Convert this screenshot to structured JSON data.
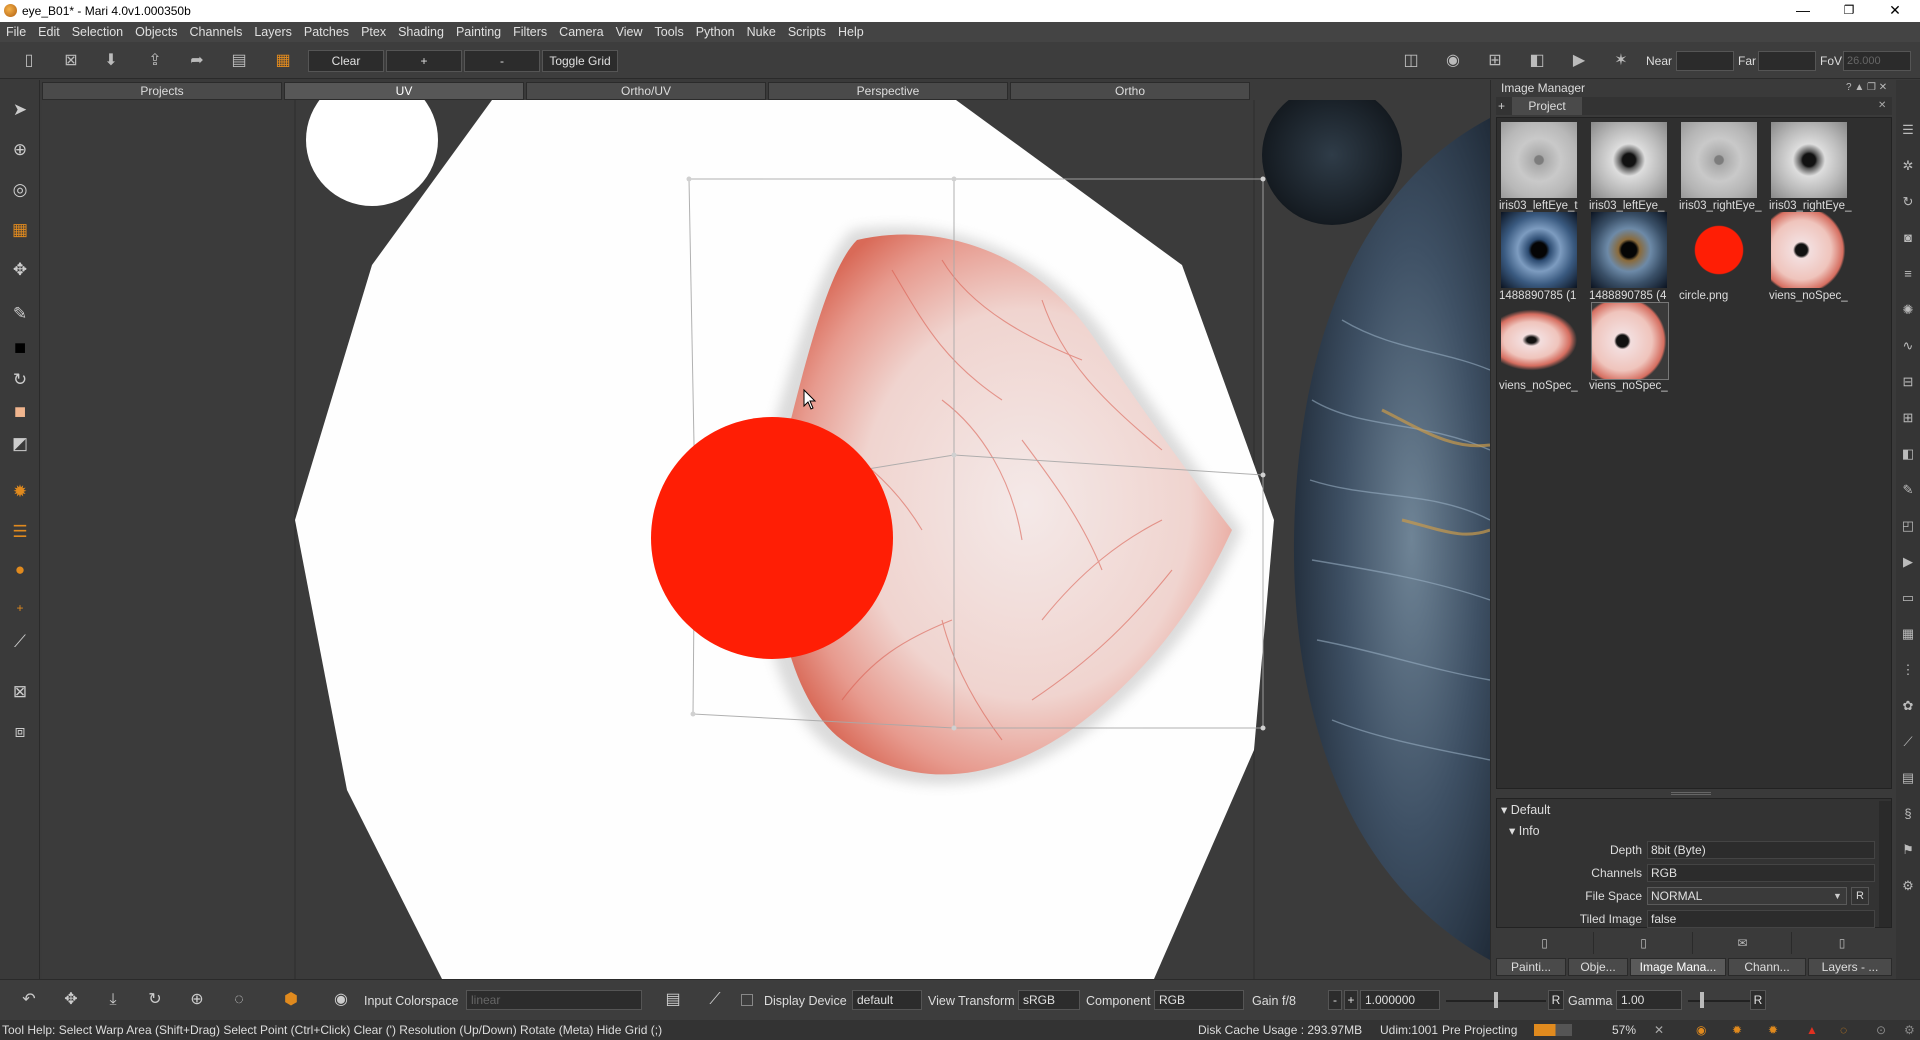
{
  "window": {
    "title": "eye_B01* - Mari 4.0v1.000350b",
    "minimize": "—",
    "restore": "❐",
    "close": "✕"
  },
  "menu": [
    "File",
    "Edit",
    "Selection",
    "Objects",
    "Channels",
    "Layers",
    "Patches",
    "Ptex",
    "Shading",
    "Painting",
    "Filters",
    "Camera",
    "View",
    "Tools",
    "Python",
    "Nuke",
    "Scripts",
    "Help"
  ],
  "toolbar": {
    "clear_label": "Clear",
    "plus_label": "+",
    "minus_label": "-",
    "toggle_grid_label": "Toggle Grid",
    "near_label": "Near",
    "far_label": "Far",
    "fov_label": "FoV",
    "fov_value": "26.000"
  },
  "viewport_tabs": [
    "Projects",
    "UV",
    "Ortho/UV",
    "Perspective",
    "Ortho"
  ],
  "active_viewport_tab": "UV",
  "image_manager": {
    "title": "Image Manager",
    "tab": "Project",
    "images": [
      {
        "caption": "iris03_leftEye_t"
      },
      {
        "caption": "iris03_leftEye_"
      },
      {
        "caption": "iris03_rightEye_"
      },
      {
        "caption": "iris03_rightEye_"
      },
      {
        "caption": "1488890785 (1"
      },
      {
        "caption": "1488890785 (4"
      },
      {
        "caption": "circle.png"
      },
      {
        "caption": "viens_noSpec_"
      },
      {
        "caption": "viens_noSpec_"
      },
      {
        "caption": "viens_noSpec_"
      }
    ]
  },
  "properties": {
    "section": "Default",
    "group": "Info",
    "rows": [
      {
        "label": "Depth",
        "value": "8bit  (Byte)"
      },
      {
        "label": "Channels",
        "value": "RGB"
      },
      {
        "label": "File Space",
        "value": "NORMAL"
      },
      {
        "label": "Tiled Image",
        "value": "false"
      }
    ],
    "r_button": "R"
  },
  "bottom_tabs": [
    "Painti...",
    "Obje...",
    "Image Mana...",
    "Chann...",
    "Layers - ..."
  ],
  "active_bottom_tab": "Image Mana...",
  "bottombar": {
    "input_colorspace_label": "Input Colorspace",
    "input_colorspace_value": "linear",
    "display_device_label": "Display Device",
    "display_device_value": "default",
    "view_transform_label": "View Transform",
    "view_transform_value": "sRGB",
    "component_label": "Component",
    "component_value": "RGB",
    "gain_label": "Gain",
    "gain_stop": "f/8",
    "gain_minus": "-",
    "gain_plus": "+",
    "gain_value": "1.000000",
    "gain_r": "R",
    "gamma_label": "Gamma",
    "gamma_value": "1.00",
    "gamma_r": "R"
  },
  "statusbar": {
    "tool_help": "Tool Help: Select Warp Area (Shift+Drag)   Select Point (Ctrl+Click)   Clear (')   Resolution (Up/Down)   Rotate (Meta)   Hide Grid (;)",
    "disk_cache": "Disk Cache Usage : 293.97MB",
    "udim": "Udim:1001",
    "pre_projecting": "Pre Projecting",
    "percent": "57%"
  },
  "colors": {
    "accent": "#e08a1e",
    "red_circle": "#ff1e05",
    "panel_bg": "#3a3a3a"
  }
}
